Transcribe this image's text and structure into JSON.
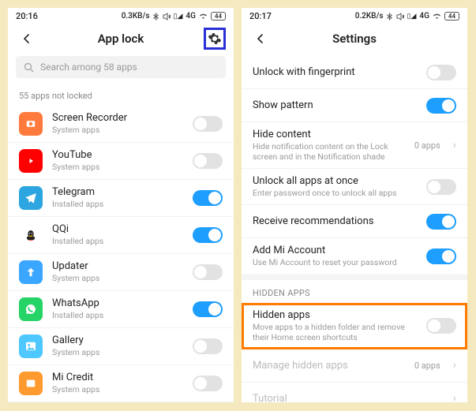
{
  "left": {
    "status": {
      "time": "20:16",
      "net": "0.3KB/s",
      "signal": "4G",
      "battery": "44"
    },
    "title": "App lock",
    "search_placeholder": "Search among 58 apps",
    "section_label": "55 apps not locked",
    "apps": [
      {
        "name": "Screen Recorder",
        "sub": "System apps",
        "on": false,
        "icon_bg": "#ff7a3c",
        "icon": "rec"
      },
      {
        "name": "YouTube",
        "sub": "System apps",
        "on": false,
        "icon_bg": "#ff0000",
        "icon": "yt"
      },
      {
        "name": "Telegram",
        "sub": "Installed apps",
        "on": true,
        "icon_bg": "#2ca5e0",
        "icon": "tg"
      },
      {
        "name": "QQi",
        "sub": "Installed apps",
        "on": true,
        "icon_bg": "#ffffff",
        "icon": "qq"
      },
      {
        "name": "Updater",
        "sub": "System apps",
        "on": false,
        "icon_bg": "#3aa6ff",
        "icon": "up"
      },
      {
        "name": "WhatsApp",
        "sub": "Installed apps",
        "on": true,
        "icon_bg": "#25d366",
        "icon": "wa"
      },
      {
        "name": "Gallery",
        "sub": "System apps",
        "on": false,
        "icon_bg": "#4fc7ff",
        "icon": "gal"
      },
      {
        "name": "Mi Credit",
        "sub": "System apps",
        "on": false,
        "icon_bg": "#ff9a2e",
        "icon": "mc"
      }
    ]
  },
  "right": {
    "status": {
      "time": "20:17",
      "net": "0.2KB/s",
      "signal": "4G",
      "battery": "44"
    },
    "title": "Settings",
    "rows": [
      {
        "title": "Unlock with fingerprint",
        "sub": "",
        "toggle": "off"
      },
      {
        "title": "Show pattern",
        "sub": "",
        "toggle": "on"
      },
      {
        "title": "Hide content",
        "sub": "Hide notification content on the Lock screen and in the Notification shade",
        "count": "0 apps",
        "chevron": true
      },
      {
        "title": "Unlock all apps at once",
        "sub": "Enter password once to unlock all apps",
        "toggle": "off"
      },
      {
        "title": "Receive recommendations",
        "sub": "",
        "toggle": "on"
      },
      {
        "title": "Add Mi Account",
        "sub": "Use Mi Account to reset your password",
        "toggle": "on"
      }
    ],
    "hidden_section_label": "HIDDEN APPS",
    "hidden_row": {
      "title": "Hidden apps",
      "sub": "Move apps to a hidden folder and remove their Home screen shortcuts",
      "toggle": "off"
    },
    "faded_rows": [
      {
        "title": "Manage hidden apps",
        "count": "0 apps",
        "chevron": true
      },
      {
        "title": "Tutorial",
        "chevron": true
      }
    ]
  }
}
